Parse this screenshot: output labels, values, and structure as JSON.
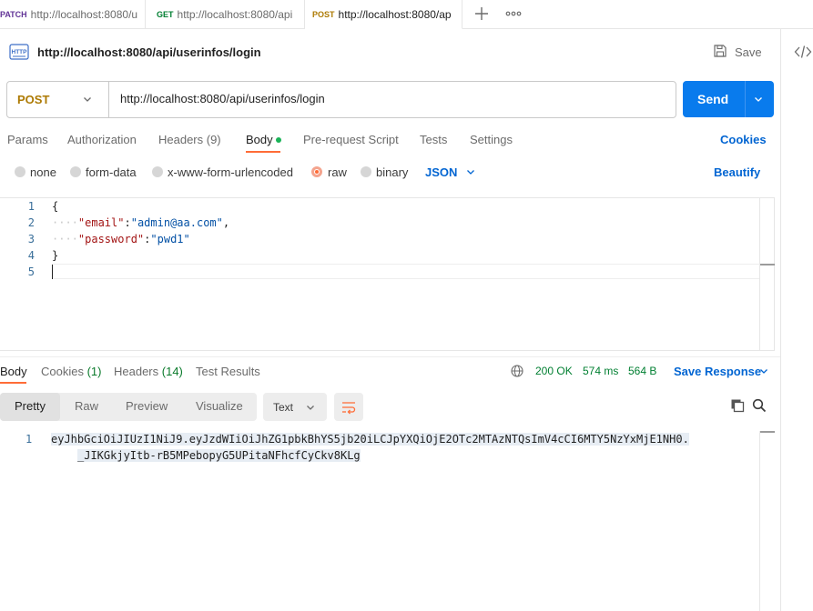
{
  "tabs": [
    {
      "method": "PATCH",
      "url": "http://localhost:8080/u"
    },
    {
      "method": "GET",
      "url": "http://localhost:8080/api"
    },
    {
      "method": "POST",
      "url": "http://localhost:8080/ap"
    }
  ],
  "request": {
    "title": "http://localhost:8080/api/userinfos/login",
    "method": "POST",
    "url": "http://localhost:8080/api/userinfos/login",
    "save_label": "Save",
    "send_label": "Send"
  },
  "request_tabs": {
    "params": "Params",
    "authorization": "Authorization",
    "headers": "Headers (9)",
    "body": "Body",
    "prerequest": "Pre-request Script",
    "tests": "Tests",
    "settings": "Settings",
    "cookies": "Cookies"
  },
  "body_types": {
    "none": "none",
    "form_data": "form-data",
    "urlencoded": "x-www-form-urlencoded",
    "raw": "raw",
    "binary": "binary",
    "format": "JSON",
    "beautify": "Beautify"
  },
  "editor_lines": [
    "{",
    "\"email\":\"admin@aa.com\",",
    "\"password\":\"pwd1\"",
    "}",
    ""
  ],
  "editor_parts": {
    "email_key": "\"email\"",
    "email_val": "\"admin@aa.com\"",
    "password_key": "\"password\"",
    "password_val": "\"pwd1\""
  },
  "line_numbers": [
    "1",
    "2",
    "3",
    "4",
    "5"
  ],
  "response": {
    "tabs": {
      "body": "Body",
      "cookies": "Cookies",
      "cookies_count": "(1)",
      "headers": "Headers",
      "headers_count": "(14)",
      "test_results": "Test Results"
    },
    "status": "200 OK",
    "time": "574 ms",
    "size": "564 B",
    "save_response": "Save Response",
    "formats": [
      "Pretty",
      "Raw",
      "Preview",
      "Visualize"
    ],
    "format_select": "Text",
    "line_number": "1",
    "body_line1": "eyJhbGciOiJIUzI1NiJ9.eyJzdWIiOiJhZG1pbkBhYS5jb20iLCJpYXQiOjE2OTc2MTAzNTQsImV4cCI6MTY5NzYxMjE1NH0.",
    "body_line2": "_JIKGkjyItb-rB5MPebopyG5UPitaNFhcfCyCkv8KLg"
  },
  "colors": {
    "accent": "#ff6c37",
    "send_button": "#097bed",
    "post_method": "#ad7a03",
    "get_method": "#007f31",
    "patch_method": "#623497",
    "status_ok": "#007f31",
    "link_blue": "#0265d2"
  }
}
